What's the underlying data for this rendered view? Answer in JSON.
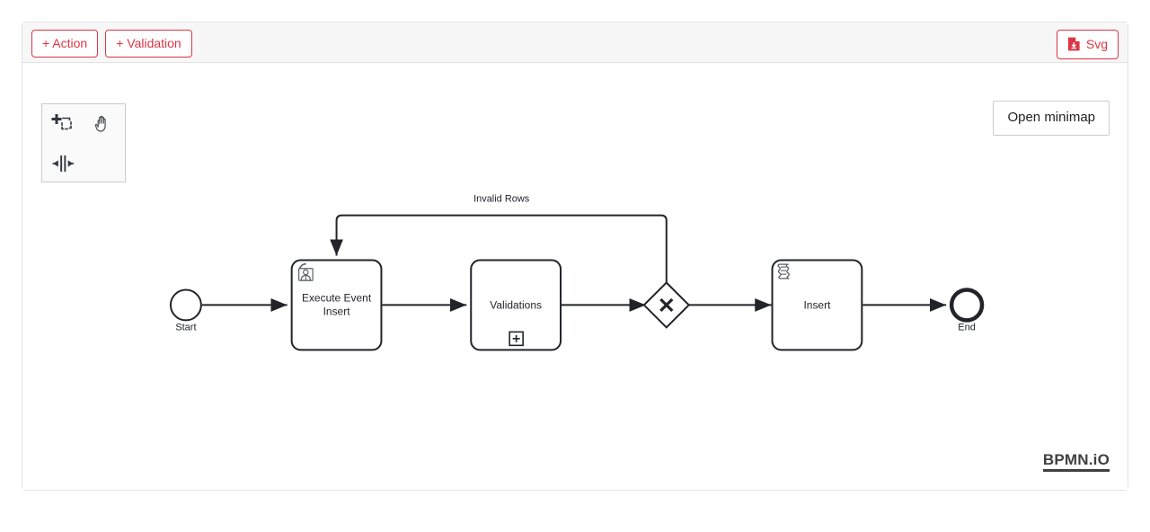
{
  "toolbar": {
    "add_action_label": "+ Action",
    "add_validation_label": "+ Validation",
    "svg_export_label": "Svg",
    "svg_icon_name": "file-download-icon"
  },
  "palette": {
    "tools": [
      {
        "name": "lasso-tool",
        "title": "Activate the lasso tool"
      },
      {
        "name": "hand-tool",
        "title": "Activate the hand tool"
      },
      {
        "name": "space-tool",
        "title": "Activate the create/remove space tool"
      }
    ]
  },
  "canvas": {
    "minimap_button_label": "Open minimap",
    "logo_label": "BPMN.iO"
  },
  "diagram": {
    "start_event": {
      "label": "Start",
      "type": "start-event"
    },
    "end_event": {
      "label": "End",
      "type": "end-event"
    },
    "tasks": [
      {
        "id": "execute-event-insert",
        "label_line1": "Execute Event",
        "label_line2": "Insert",
        "marker": "user-task-icon"
      },
      {
        "id": "validations",
        "label_line1": "Validations",
        "label_line2": "",
        "marker": "collapsed-subprocess-plus-icon"
      },
      {
        "id": "insert",
        "label_line1": "Insert",
        "label_line2": "",
        "marker": "script-task-icon"
      }
    ],
    "gateway": {
      "id": "exclusive-gateway",
      "type": "exclusive-gateway",
      "label": ""
    },
    "flows": [
      {
        "id": "flow-start-execute",
        "label": ""
      },
      {
        "id": "flow-execute-validations",
        "label": ""
      },
      {
        "id": "flow-validations-gateway",
        "label": ""
      },
      {
        "id": "flow-gateway-insert",
        "label": ""
      },
      {
        "id": "flow-insert-end",
        "label": ""
      },
      {
        "id": "flow-gateway-execute",
        "label": "Invalid Rows"
      }
    ]
  },
  "colors": {
    "danger": "#dc3545",
    "stroke": "#22242a",
    "header_bg": "#f7f7f7",
    "border": "#e3e3e3"
  }
}
